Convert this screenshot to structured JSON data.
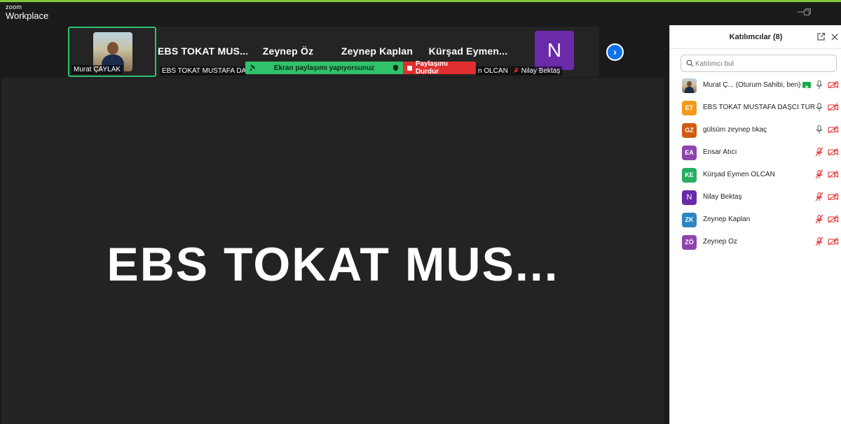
{
  "app": {
    "logo_top": "zoom",
    "logo_bottom": "Workplace",
    "accent_color": "#7ec83a",
    "active_border_color": "#2fc26b"
  },
  "window_controls": [
    "minimize-icon",
    "restore-icon"
  ],
  "gallery_strip": {
    "tiles": [
      {
        "big_name": "",
        "name_tag": "Murat ÇAYLAK",
        "has_photo": true,
        "active": true
      },
      {
        "big_name": "EBS  TOKAT  MUS...",
        "name_tag": "EBS TOKAT MUSTAFA DAŞ..."
      },
      {
        "big_name": "Zeynep Öz",
        "name_tag": ""
      },
      {
        "big_name": "Zeynep Kaplan",
        "name_tag": ""
      },
      {
        "big_name": "Kürşad  Eymen...",
        "name_tag": "n OLCAN"
      },
      {
        "big_name": "",
        "name_tag": "Nilay Bektaş",
        "avatar_letter": "N",
        "avatar_color": "#6b2aa8",
        "muted": true
      }
    ],
    "next_icon": "chevron-right-icon"
  },
  "share_bar": {
    "status_text": "Ekran paylaşımı yapıyorsunuz",
    "stop_label": "Paylaşımı Durdur",
    "status_color": "#2fc26b",
    "stop_color": "#e02f2f"
  },
  "stage": {
    "display_name": "EBS  TOKAT  MUS..."
  },
  "participants_panel": {
    "title": "Katılımcılar (8)",
    "search_placeholder": "Katılımcı bul",
    "participants": [
      {
        "name": "Murat Ç...",
        "role": "(Oturum Sahibi, ben)",
        "initials": "",
        "color": "",
        "photo": true,
        "sharing": true,
        "mic": "on",
        "video": "off"
      },
      {
        "name": "EBS TOKAT MUSTAFA DAŞCI TUR...",
        "role": "",
        "initials": "ET",
        "color": "#f39a1b",
        "mic": "on",
        "video": "off"
      },
      {
        "name": "gülsüm zeynep tıkaç",
        "role": "",
        "initials": "GZ",
        "color": "#d05a12",
        "mic": "on",
        "video": "off"
      },
      {
        "name": "Ensar Atıcı",
        "role": "",
        "initials": "EA",
        "color": "#8e44ad",
        "mic": "muted",
        "video": "off"
      },
      {
        "name": "Kürşad Eymen OLCAN",
        "role": "",
        "initials": "KE",
        "color": "#27ae60",
        "mic": "muted",
        "video": "off"
      },
      {
        "name": "Nilay Bektaş",
        "role": "",
        "initials": "N",
        "color": "#6b2aa8",
        "mic": "muted",
        "video": "off"
      },
      {
        "name": "Zeynep Kaplan",
        "role": "",
        "initials": "ZK",
        "color": "#2e86c1",
        "mic": "muted",
        "video": "off"
      },
      {
        "name": "Zeynep Öz",
        "role": "",
        "initials": "ZÖ",
        "color": "#8e44ad",
        "mic": "muted",
        "video": "off"
      }
    ]
  }
}
